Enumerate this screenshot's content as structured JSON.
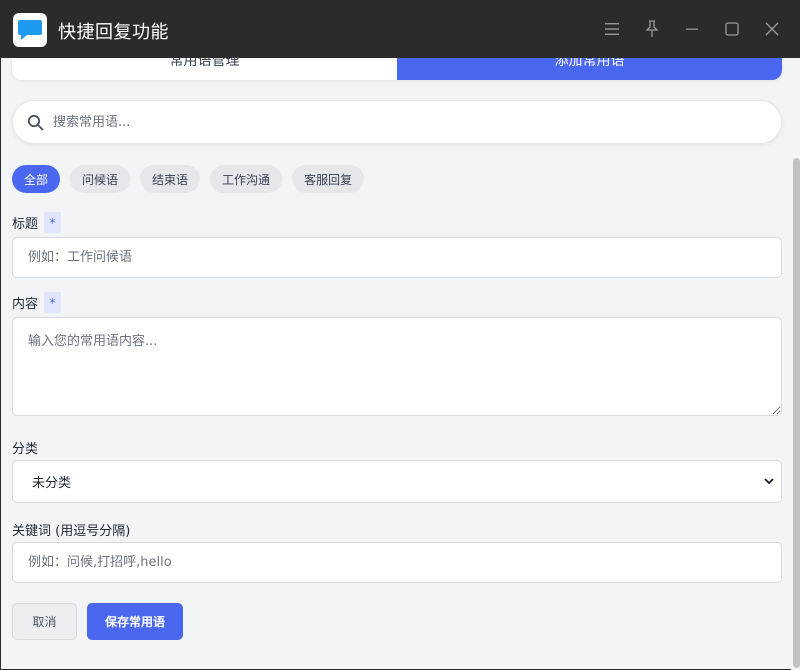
{
  "app": {
    "title": "快捷回复功能"
  },
  "tabs": [
    {
      "label": "常用语管理",
      "active": false
    },
    {
      "label": "添加常用语",
      "active": true
    }
  ],
  "search": {
    "placeholder": "搜索常用语..."
  },
  "categories": [
    {
      "label": "全部",
      "active": true
    },
    {
      "label": "问候语",
      "active": false
    },
    {
      "label": "结束语",
      "active": false
    },
    {
      "label": "工作沟通",
      "active": false
    },
    {
      "label": "客服回复",
      "active": false
    }
  ],
  "form": {
    "title_label": "标题",
    "title_placeholder": "例如：工作问候语",
    "content_label": "内容",
    "content_placeholder": "输入您的常用语内容...",
    "category_label": "分类",
    "category_value": "未分类",
    "keywords_label": "关键词 (用逗号分隔)",
    "keywords_placeholder": "例如：问候,打招呼,hello",
    "required_mark": "*",
    "cancel_label": "取消",
    "save_label": "保存常用语"
  },
  "colors": {
    "accent": "#4a67f0",
    "titlebar": "#2b2b2b",
    "logo": "#1e9bf0"
  },
  "icons": [
    "chat-bubble-icon",
    "menu-icon",
    "pin-icon",
    "minimize-icon",
    "maximize-icon",
    "close-icon",
    "search-icon",
    "chevron-down-icon"
  ]
}
